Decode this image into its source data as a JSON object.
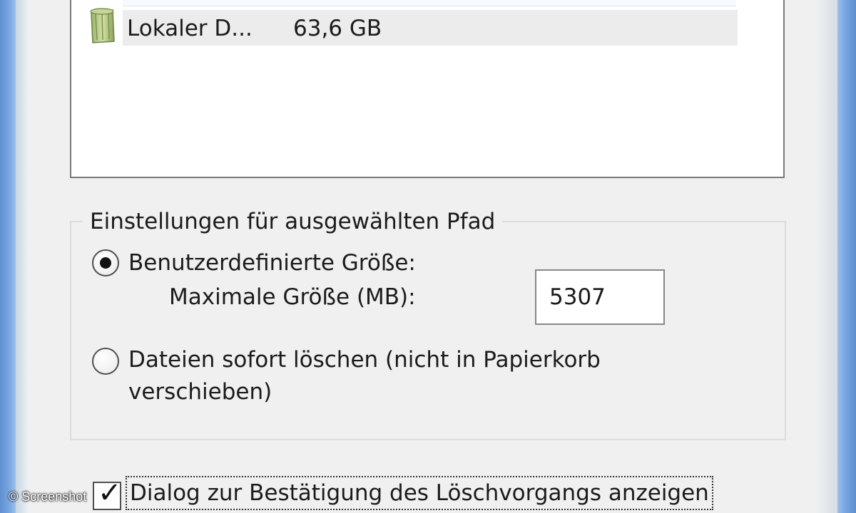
{
  "drive_list": {
    "items": [
      {
        "name": "Lokaler D...",
        "size": "63,6 GB",
        "icon": "recycle-bin-icon"
      }
    ]
  },
  "settings": {
    "group_title": "Einstellungen für ausgewählten Pfad",
    "custom_size_label": "Benutzerdefinierte Größe:",
    "custom_size_selected": true,
    "max_size_label": "Maximale Größe (MB):",
    "max_size_value": "5307",
    "delete_immediately_label_line1": "Dateien sofort löschen (nicht in Papierkorb",
    "delete_immediately_label_line2": "verschieben)",
    "delete_immediately_selected": false
  },
  "confirm_dialog": {
    "label": "Dialog zur Bestätigung des Löschvorgangs anzeigen",
    "checked": true
  },
  "watermark": "© Screenshot"
}
